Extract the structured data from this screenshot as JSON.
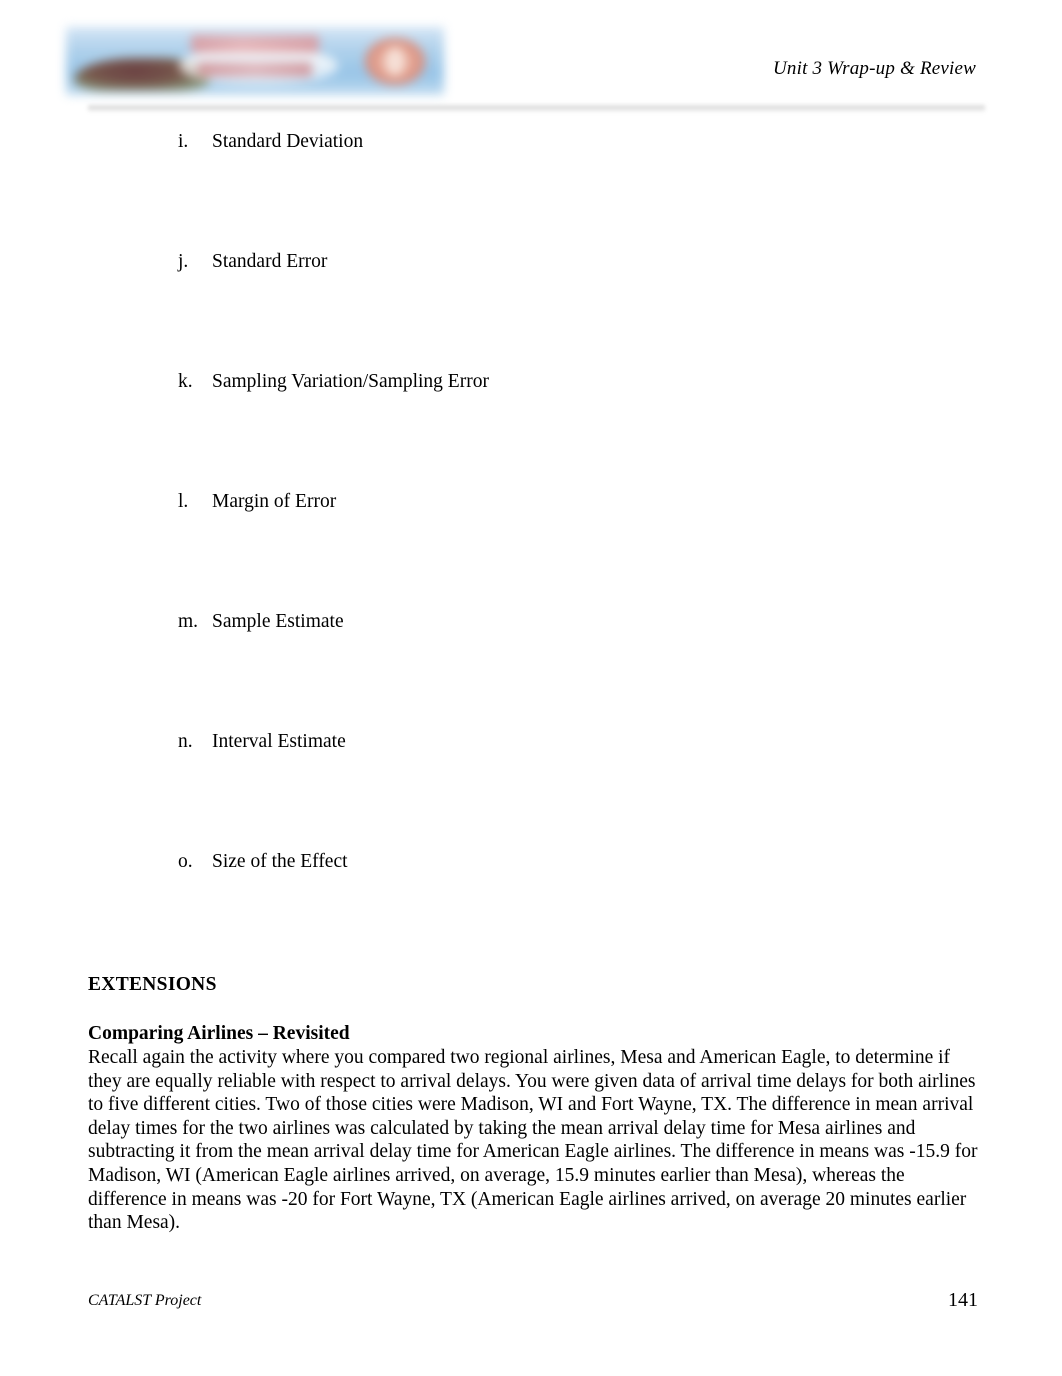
{
  "header": {
    "title": "Unit 3 Wrap-up & Review",
    "banner_alt": "catalst-banner-image",
    "banner_colors": {
      "background": "#a8cdea",
      "text": "#d98f93",
      "logo": "#cf7b6a",
      "rule": "#a5a5a5"
    }
  },
  "term_list": {
    "items": [
      {
        "marker": "i.",
        "label": "Standard Deviation"
      },
      {
        "marker": "j.",
        "label": "Standard Error"
      },
      {
        "marker": "k.",
        "label": "Sampling Variation/Sampling Error"
      },
      {
        "marker": "l.",
        "label": "Margin of Error"
      },
      {
        "marker": "m.",
        "label": "Sample Estimate"
      },
      {
        "marker": "n.",
        "label": "Interval Estimate"
      },
      {
        "marker": "o.",
        "label": "Size of the Effect"
      }
    ]
  },
  "extensions": {
    "heading": "EXTENSIONS"
  },
  "subsection": {
    "heading": "Comparing Airlines – Revisited",
    "body": "Recall again the activity where you compared two regional airlines, Mesa and American Eagle, to determine if they are equally reliable with respect to arrival delays. You were given data of arrival time delays for both airlines to five different cities. Two of those cities were Madison, WI and Fort Wayne, TX. The difference in mean arrival delay times for the two airlines was calculated by taking the mean arrival delay time for Mesa airlines and subtracting it from the mean arrival delay time for American Eagle airlines. The difference in means was -15.9 for Madison, WI (American Eagle airlines arrived, on average, 15.9 minutes earlier than Mesa), whereas the difference in means was -20 for Fort Wayne, TX (American Eagle airlines arrived, on average 20 minutes earlier than Mesa)."
  },
  "footer": {
    "left": "CATALST Project",
    "page_number": "141"
  }
}
